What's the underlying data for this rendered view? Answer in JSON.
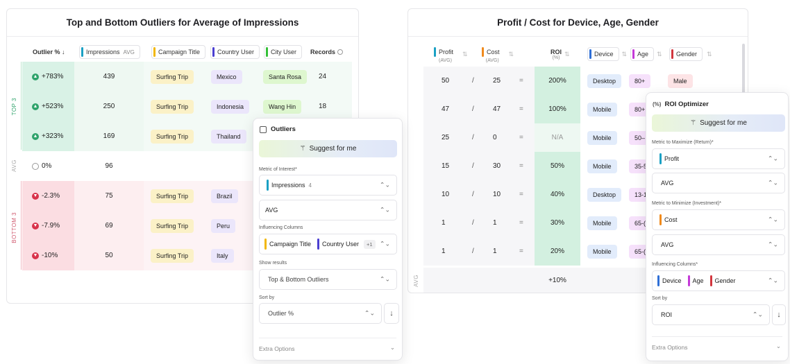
{
  "left": {
    "title": "Top and Bottom Outliers for Average of Impressions",
    "headers": {
      "outlier": "Outlier % ↓",
      "impressions": "Impressions",
      "impressions_agg": "AVG",
      "campaign": "Campaign Title",
      "country": "Country User",
      "city": "City User",
      "records": "Records"
    },
    "top_label": "TOP 3",
    "avg_label": "AVG",
    "bottom_label": "BOTTOM 3",
    "rows": [
      {
        "pct": "+783%",
        "imp": "439",
        "campaign": "Surfing Trip",
        "country": "Mexico",
        "city": "Santa Rosa",
        "records": "24"
      },
      {
        "pct": "+523%",
        "imp": "250",
        "campaign": "Surfing Trip",
        "country": "Indonesia",
        "city": "Wang Hin",
        "records": "18"
      },
      {
        "pct": "+323%",
        "imp": "169",
        "campaign": "Surfing Trip",
        "country": "Thailand",
        "city": "",
        "records": ""
      },
      {
        "pct": "0%",
        "imp": "96",
        "campaign": "",
        "country": "",
        "city": "",
        "records": ""
      },
      {
        "pct": "-2.3%",
        "imp": "75",
        "campaign": "Surfing Trip",
        "country": "Brazil",
        "city": "",
        "records": ""
      },
      {
        "pct": "-7.9%",
        "imp": "69",
        "campaign": "Surfing Trip",
        "country": "Peru",
        "city": "",
        "records": ""
      },
      {
        "pct": "-10%",
        "imp": "50",
        "campaign": "Surfing Trip",
        "country": "Italy",
        "city": "",
        "records": ""
      }
    ]
  },
  "outliers_popup": {
    "title": "Outliers",
    "suggest": "Suggest for me",
    "metric_label": "Metric of Interest*",
    "metric_value": "Impressions",
    "metric_count": "4",
    "agg_value": "AVG",
    "influencing_label": "Influencing Columns",
    "influencing_1": "Campaign Title",
    "influencing_2": "Country User",
    "influencing_more": "+1",
    "show_label": "Show results",
    "show_value": "Top & Bottom Outliers",
    "sort_label": "Sort by",
    "sort_value": "Outlier %",
    "extra": "Extra Options"
  },
  "right": {
    "title": "Profit / Cost for Device, Age, Gender",
    "headers": {
      "profit": "Profit",
      "profit_agg": "(AVG)",
      "cost": "Cost",
      "cost_agg": "(AVG)",
      "roi": "ROI",
      "roi_unit": "(%)",
      "device": "Device",
      "age": "Age",
      "gender": "Gender"
    },
    "slash": "/",
    "equals": "=",
    "rows": [
      {
        "profit": "50",
        "cost": "25",
        "roi": "200%",
        "device": "Desktop",
        "age": "80+",
        "gender": "Male"
      },
      {
        "profit": "47",
        "cost": "47",
        "roi": "100%",
        "device": "Mobile",
        "age": "80+",
        "gender": ""
      },
      {
        "profit": "25",
        "cost": "0",
        "roi": "N/A",
        "device": "Mobile",
        "age": "50–",
        "gender": ""
      },
      {
        "profit": "15",
        "cost": "30",
        "roi": "50%",
        "device": "Mobile",
        "age": "35-5",
        "gender": ""
      },
      {
        "profit": "10",
        "cost": "10",
        "roi": "40%",
        "device": "Desktop",
        "age": "13-1",
        "gender": ""
      },
      {
        "profit": "1",
        "cost": "1",
        "roi": "30%",
        "device": "Mobile",
        "age": "65-(",
        "gender": ""
      },
      {
        "profit": "1",
        "cost": "1",
        "roi": "20%",
        "device": "Mobile",
        "age": "65-(",
        "gender": ""
      }
    ],
    "avg_label": "AVG",
    "avg_roi": "+10%"
  },
  "roi_popup": {
    "title": "ROI Optimizer",
    "suggest": "Suggest for me",
    "max_label": "Metric to Maximize (Return)*",
    "max_value": "Profit",
    "max_agg": "AVG",
    "min_label": "Metric to Minimize (Investment)*",
    "min_value": "Cost",
    "min_agg": "AVG",
    "influencing_label": "Influencing Columns*",
    "inf_1": "Device",
    "inf_2": "Age",
    "inf_3": "Gender",
    "sort_label": "Sort by",
    "sort_value": "ROI",
    "extra": "Extra Options"
  },
  "colors": {
    "green_bg": "#d9f2e6",
    "green_light": "#eef8f2",
    "red_bg": "#fbdde2",
    "red_light": "#fdeef0",
    "campaign_tag": "#fbf1c7",
    "country_tag": "#ebe6fb",
    "city_tag": "#def7cf",
    "device_tag": "#e2ecfb",
    "age_tag": "#f6e1fb",
    "gender_tag": "#fde4e6"
  }
}
